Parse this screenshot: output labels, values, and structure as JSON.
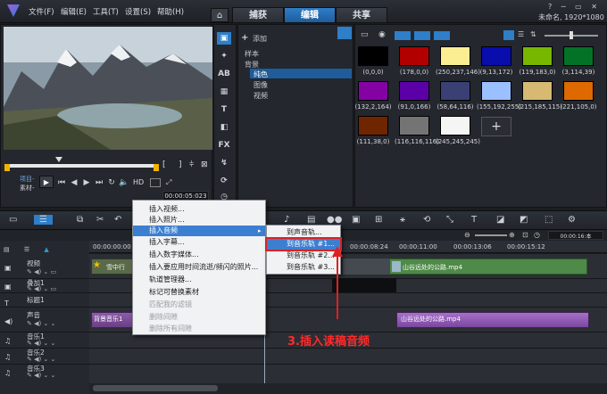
{
  "menu": {
    "file": "文件(F)",
    "edit": "编辑(E)",
    "tools": "工具(T)",
    "settings": "设置(S)",
    "help": "帮助(H)"
  },
  "tabs": {
    "capture": "捕获",
    "edit": "编辑",
    "share": "共享"
  },
  "project_info": "未命名, 1920*1080",
  "player": {
    "project_label": "项目-",
    "clip_label": "素材-",
    "hd": "HD",
    "timecode": "00:00:05:023"
  },
  "library": {
    "add": "添加",
    "tree": [
      "样本",
      "背景",
      "纯色",
      "图像",
      "视频"
    ]
  },
  "swatches": [
    {
      "label": "(0,0,0)",
      "color": "#000000"
    },
    {
      "label": "(178,0,0)",
      "color": "#b20000"
    },
    {
      "label": "(250,237,146)",
      "color": "#faed92"
    },
    {
      "label": "(9,13,172)",
      "color": "#090dac"
    },
    {
      "label": "(119,183,0)",
      "color": "#77b700"
    },
    {
      "label": "(3,114,39)",
      "color": "#037227"
    },
    {
      "label": "(132,2,164)",
      "color": "#8402a4"
    },
    {
      "label": "(91,0,166)",
      "color": "#5b00a6"
    },
    {
      "label": "(58,64,116)",
      "color": "#3a4074"
    },
    {
      "label": "(155,192,255)",
      "color": "#9bc0ff"
    },
    {
      "label": "(215,185,115)",
      "color": "#d7b973"
    },
    {
      "label": "(221,105,0)",
      "color": "#dd6900"
    },
    {
      "label": "(111,38,0)",
      "color": "#6f2600"
    },
    {
      "label": "(116,116,116)",
      "color": "#747474"
    },
    {
      "label": "(245,245,245)",
      "color": "#f5f5f5"
    }
  ],
  "timeline": {
    "ruler": [
      "00:00:00:00",
      "00:00:08:24",
      "00:00:11:00",
      "00:00:13:06",
      "00:00:15:12"
    ],
    "tc": "00:00:16:本",
    "tracks": [
      "视频",
      "叠加1",
      "标题1",
      "声音",
      "音乐1",
      "音乐2",
      "音乐3"
    ],
    "clips": {
      "video1": "雪中行",
      "video2": "山谷远处的公路.mp4",
      "audio1": "背景音乐1",
      "audio2": "山谷远处的公路.mp4"
    }
  },
  "context_menu": {
    "items": [
      "插入视频...",
      "插入照片...",
      "插入音频",
      "插入字幕...",
      "插入数字媒体...",
      "插入要应用时间流逝/频闪的照片...",
      "轨道管理器...",
      "标记可替换素材",
      "匹配我的滤镜",
      "删除间隙",
      "删除所有间隙"
    ]
  },
  "submenu": {
    "items": [
      "到声音轨...",
      "到音乐轨 #1...",
      "到音乐轨 #2...",
      "到音乐轨 #3..."
    ]
  },
  "annotation": "3.插入读稿音频"
}
